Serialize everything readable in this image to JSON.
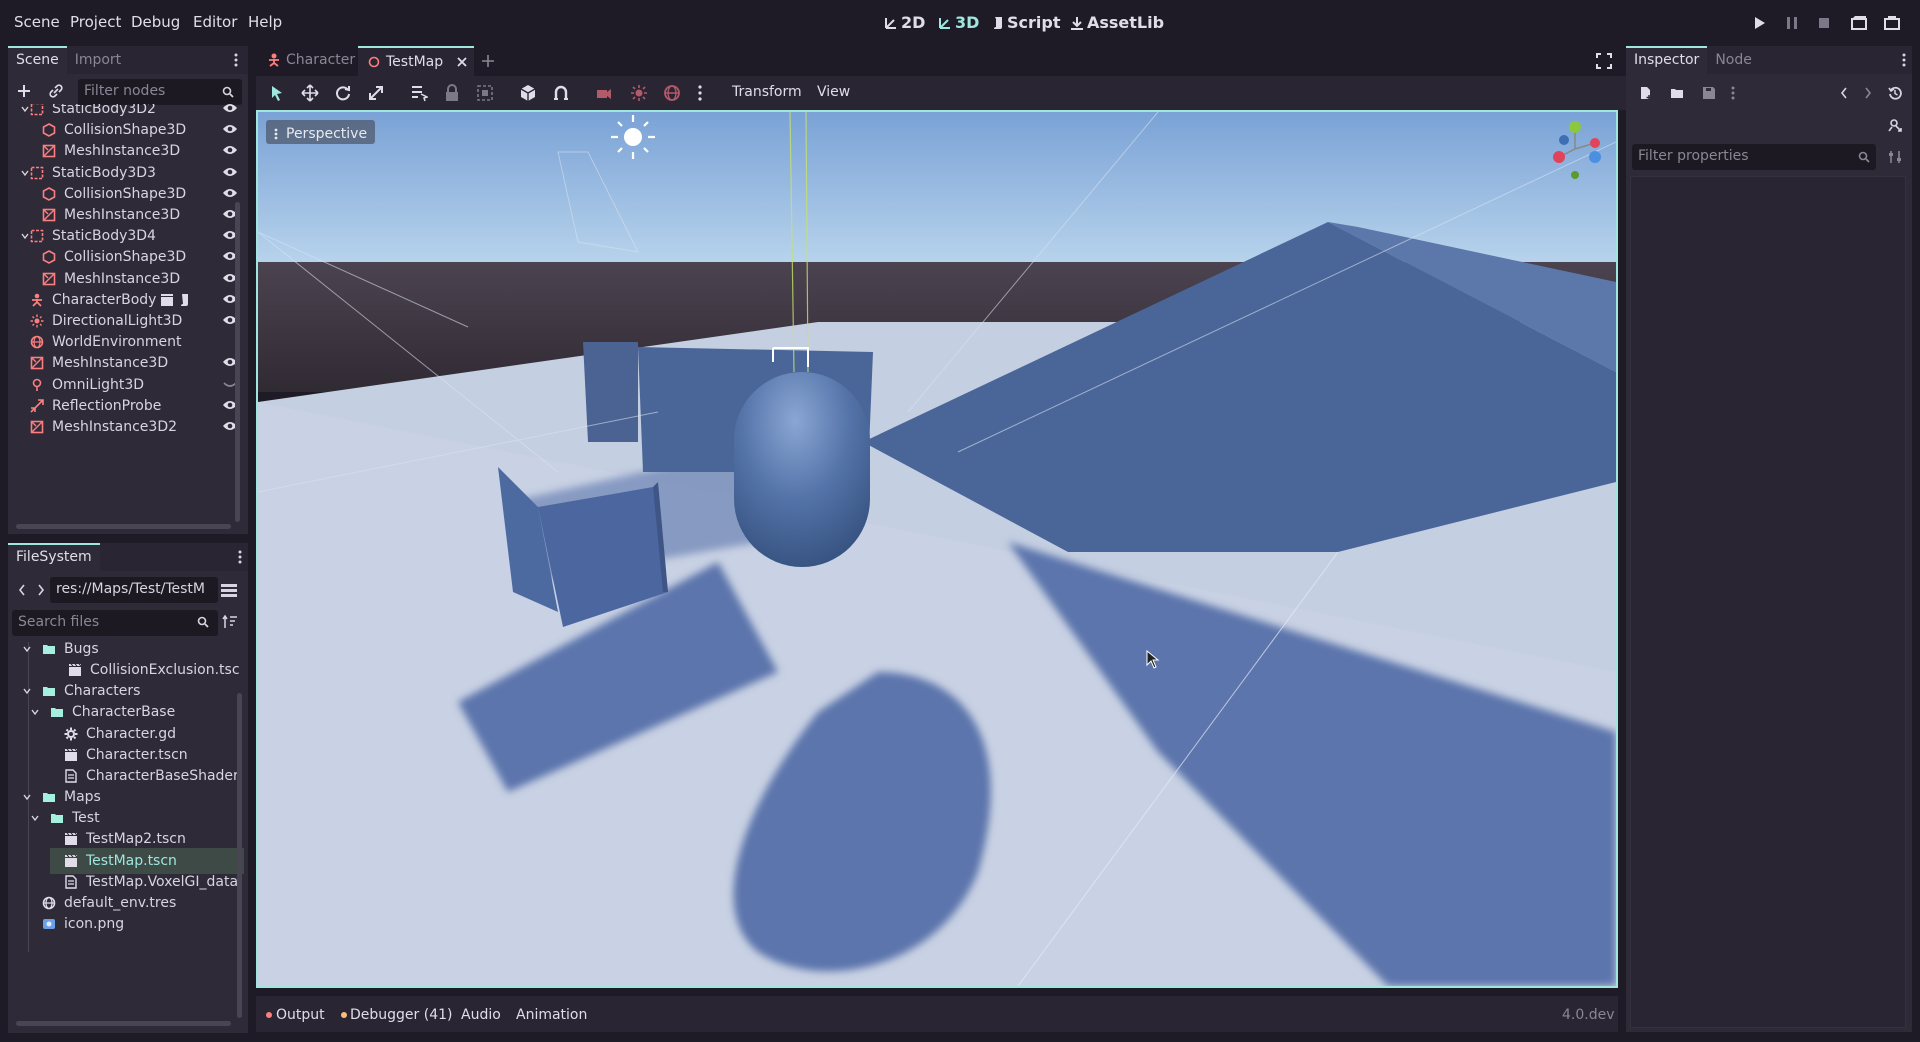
{
  "menubar": {
    "items": [
      "Scene",
      "Project",
      "Debug",
      "Editor",
      "Help"
    ],
    "workspaces": [
      "2D",
      "3D",
      "Script",
      "AssetLib"
    ],
    "active_workspace": "3D"
  },
  "scene_dock": {
    "tabs": [
      "Scene",
      "Import"
    ],
    "filter_placeholder": "Filter nodes",
    "nodes": [
      {
        "label": "StaticBody3D2",
        "type": "static",
        "indent": 1,
        "expanded": true,
        "eye": true
      },
      {
        "label": "CollisionShape3D",
        "type": "collision",
        "indent": 2,
        "eye": true
      },
      {
        "label": "MeshInstance3D",
        "type": "mesh",
        "indent": 2,
        "eye": true
      },
      {
        "label": "StaticBody3D3",
        "type": "static",
        "indent": 1,
        "expanded": true,
        "eye": true
      },
      {
        "label": "CollisionShape3D",
        "type": "collision",
        "indent": 2,
        "eye": true
      },
      {
        "label": "MeshInstance3D",
        "type": "mesh",
        "indent": 2,
        "eye": true
      },
      {
        "label": "StaticBody3D4",
        "type": "static",
        "indent": 1,
        "expanded": true,
        "eye": true
      },
      {
        "label": "CollisionShape3D",
        "type": "collision",
        "indent": 2,
        "eye": true
      },
      {
        "label": "MeshInstance3D",
        "type": "mesh",
        "indent": 2,
        "eye": true
      },
      {
        "label": "CharacterBody",
        "type": "character",
        "indent": 1,
        "eye": true
      },
      {
        "label": "DirectionalLight3D",
        "type": "light",
        "indent": 1,
        "eye": true
      },
      {
        "label": "WorldEnvironment",
        "type": "world",
        "indent": 1,
        "eye": false
      },
      {
        "label": "MeshInstance3D",
        "type": "mesh",
        "indent": 1,
        "eye": true
      },
      {
        "label": "OmniLight3D",
        "type": "omni",
        "indent": 1,
        "eye": false
      },
      {
        "label": "ReflectionProbe",
        "type": "probe",
        "indent": 1,
        "eye": true
      },
      {
        "label": "MeshInstance3D2",
        "type": "mesh",
        "indent": 1,
        "eye": true
      }
    ]
  },
  "filesystem": {
    "title": "FileSystem",
    "path": "res://Maps/Test/TestM",
    "search_placeholder": "Search files",
    "items": [
      {
        "label": "Bugs",
        "type": "folder",
        "indent": 1
      },
      {
        "label": "CollisionExclusion.tscn",
        "type": "scene",
        "indent": 2
      },
      {
        "label": "Characters",
        "type": "folder",
        "indent": 1
      },
      {
        "label": "CharacterBase",
        "type": "folder",
        "indent": 2
      },
      {
        "label": "Character.gd",
        "type": "script",
        "indent": 3
      },
      {
        "label": "Character.tscn",
        "type": "scene",
        "indent": 3
      },
      {
        "label": "CharacterBaseShader.t",
        "type": "resource",
        "indent": 3
      },
      {
        "label": "Maps",
        "type": "folder",
        "indent": 1
      },
      {
        "label": "Test",
        "type": "folder",
        "indent": 2
      },
      {
        "label": "TestMap2.tscn",
        "type": "scene",
        "indent": 3
      },
      {
        "label": "TestMap.tscn",
        "type": "scene",
        "indent": 3,
        "selected": true
      },
      {
        "label": "TestMap.VoxelGI_data.r",
        "type": "resource",
        "indent": 3
      },
      {
        "label": "default_env.tres",
        "type": "env",
        "indent": 1
      },
      {
        "label": "icon.png",
        "type": "image",
        "indent": 1
      }
    ]
  },
  "scene_tabs": [
    "Character",
    "TestMap"
  ],
  "viewport_toolbar": {
    "menus": [
      "Transform",
      "View"
    ]
  },
  "viewport": {
    "perspective_label": "Perspective"
  },
  "bottom_panel": {
    "tabs": [
      "Output",
      "Debugger (41)",
      "Audio",
      "Animation"
    ],
    "version": "4.0.dev"
  },
  "inspector": {
    "tabs": [
      "Inspector",
      "Node"
    ],
    "filter_placeholder": "Filter properties"
  },
  "colors": {
    "accent": "#9fe6de",
    "node_red": "#fc7f7f",
    "folder": "#a5efdf",
    "bg": "#1f1b26",
    "panel": "#2a2533"
  }
}
